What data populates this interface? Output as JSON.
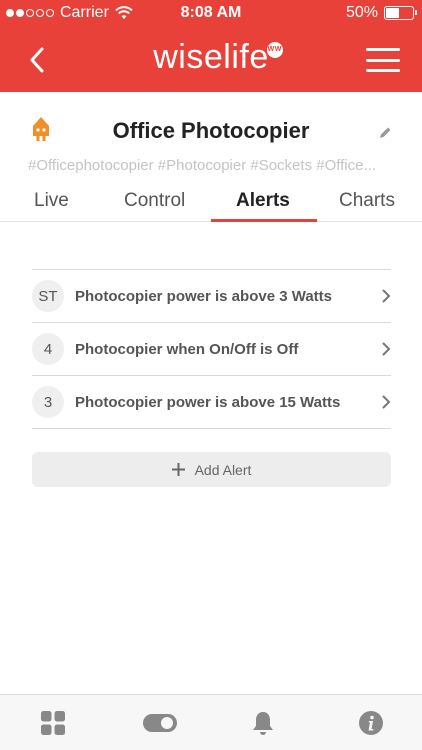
{
  "status_bar": {
    "carrier": "Carrier",
    "time": "8:08 AM",
    "battery_percent": "50%",
    "battery_level": 0.5,
    "signal_bars": 2
  },
  "nav": {
    "logo": "wiselife",
    "logo_badge": "WW",
    "back_icon": "chevron-left-icon",
    "menu_icon": "hamburger-menu-icon"
  },
  "device": {
    "title": "Office Photocopier",
    "tags": "#Officephotocopier #Photocopier #Sockets #Office...",
    "icon": "plug-icon",
    "edit_icon": "pencil-icon"
  },
  "tabs": [
    {
      "label": "Live"
    },
    {
      "label": "Control"
    },
    {
      "label": "Alerts",
      "active": true
    },
    {
      "label": "Charts"
    }
  ],
  "alerts": [
    {
      "badge": "ST",
      "text": "Photocopier power is above 3 Watts"
    },
    {
      "badge": "4",
      "text": "Photocopier when On/Off is Off"
    },
    {
      "badge": "3",
      "text": "Photocopier power is above 15 Watts"
    }
  ],
  "add_alert": {
    "label": "Add Alert"
  },
  "bottom_bar": [
    "grid-icon",
    "toggle-icon",
    "bell-icon",
    "info-icon"
  ],
  "colors": {
    "brand_red": "#e8413a",
    "plug_orange": "#f0902a",
    "icon_gray": "#888888"
  }
}
